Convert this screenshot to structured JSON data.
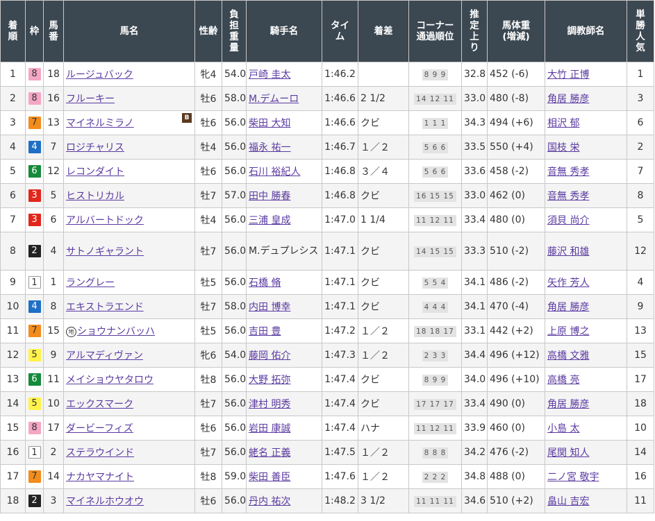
{
  "headers": {
    "rank": "着順",
    "waku": "枠",
    "umaban": "馬番",
    "horse": "馬名",
    "sexage": "性齢",
    "weight": "負担重量",
    "jockey": "騎手名",
    "time": "タイム",
    "margin": "着差",
    "corner": "コーナー通過順位",
    "last3f": "推定上り",
    "bodyweight": "馬体重(増減)",
    "trainer": "調教師名",
    "popularity": "単勝人気"
  },
  "badges": {
    "blinker": "B",
    "chiho": "地"
  },
  "rows": [
    {
      "rank": "1",
      "waku": "8",
      "umaban": "18",
      "horse": "ルージュバック",
      "sexage": "牝4",
      "weight": "54.0",
      "jockey": "戸崎 圭太",
      "time": "1:46.2",
      "margin": "",
      "corner": "8 9 9",
      "last3f": "32.8",
      "bodyweight": "452 (-6)",
      "trainer": "大竹 正博",
      "popularity": "1"
    },
    {
      "rank": "2",
      "waku": "8",
      "umaban": "16",
      "horse": "フルーキー",
      "sexage": "牡6",
      "weight": "58.0",
      "jockey": "M.デムーロ",
      "time": "1:46.6",
      "margin": "2 1/2",
      "corner": "14 12 11",
      "last3f": "33.0",
      "bodyweight": "480 (-8)",
      "trainer": "角居 勝彦",
      "popularity": "3"
    },
    {
      "rank": "3",
      "waku": "7",
      "umaban": "13",
      "horse": "マイネルミラノ",
      "sexage": "牡6",
      "weight": "56.0",
      "jockey": "柴田 大知",
      "time": "1:46.6",
      "margin": "クビ",
      "corner": "1 1 1",
      "last3f": "34.3",
      "bodyweight": "494 (+6)",
      "trainer": "相沢 郁",
      "popularity": "6"
    },
    {
      "rank": "4",
      "waku": "4",
      "umaban": "7",
      "horse": "ロジチャリス",
      "sexage": "牡4",
      "weight": "56.0",
      "jockey": "福永 祐一",
      "time": "1:46.7",
      "margin": "１／２",
      "corner": "5 6 6",
      "last3f": "33.5",
      "bodyweight": "550 (+4)",
      "trainer": "国枝 栄",
      "popularity": "2"
    },
    {
      "rank": "5",
      "waku": "6",
      "umaban": "12",
      "horse": "レコンダイト",
      "sexage": "牡6",
      "weight": "56.0",
      "jockey": "石川 裕紀人",
      "time": "1:46.8",
      "margin": "３／４",
      "corner": "5 6 6",
      "last3f": "33.6",
      "bodyweight": "458 (-2)",
      "trainer": "音無 秀孝",
      "popularity": "7"
    },
    {
      "rank": "6",
      "waku": "3",
      "umaban": "5",
      "horse": "ヒストリカル",
      "sexage": "牡7",
      "weight": "57.0",
      "jockey": "田中 勝春",
      "time": "1:46.8",
      "margin": "クビ",
      "corner": "16 15 15",
      "last3f": "33.0",
      "bodyweight": "462 (0)",
      "trainer": "音無 秀孝",
      "popularity": "8"
    },
    {
      "rank": "7",
      "waku": "3",
      "umaban": "6",
      "horse": "アルバートドック",
      "sexage": "牡4",
      "weight": "56.0",
      "jockey": "三浦 皇成",
      "time": "1:47.0",
      "margin": "1 1/4",
      "corner": "11 12 11",
      "last3f": "33.4",
      "bodyweight": "480 (0)",
      "trainer": "須貝 尚介",
      "popularity": "5"
    },
    {
      "rank": "8",
      "waku": "2",
      "umaban": "4",
      "horse": "サトノギャラント",
      "sexage": "牡7",
      "weight": "56.0",
      "jockey": "M.デュプレシス",
      "time": "1:47.1",
      "margin": "クビ",
      "corner": "14 15 15",
      "last3f": "33.3",
      "bodyweight": "510 (-2)",
      "trainer": "藤沢 和雄",
      "popularity": "12"
    },
    {
      "rank": "9",
      "waku": "1",
      "umaban": "1",
      "horse": "ラングレー",
      "sexage": "牡5",
      "weight": "56.0",
      "jockey": "石橋 脩",
      "time": "1:47.1",
      "margin": "クビ",
      "corner": "5 5 4",
      "last3f": "34.1",
      "bodyweight": "486 (-2)",
      "trainer": "矢作 芳人",
      "popularity": "4"
    },
    {
      "rank": "10",
      "waku": "4",
      "umaban": "8",
      "horse": "エキストラエンド",
      "sexage": "牡7",
      "weight": "58.0",
      "jockey": "内田 博幸",
      "time": "1:47.1",
      "margin": "クビ",
      "corner": "4 4 4",
      "last3f": "34.1",
      "bodyweight": "470 (-4)",
      "trainer": "角居 勝彦",
      "popularity": "9"
    },
    {
      "rank": "11",
      "waku": "7",
      "umaban": "15",
      "horse": "ショウナンバッハ",
      "sexage": "牡5",
      "weight": "56.0",
      "jockey": "吉田 豊",
      "time": "1:47.2",
      "margin": "１／２",
      "corner": "18 18 17",
      "last3f": "33.1",
      "bodyweight": "442 (+2)",
      "trainer": "上原 博之",
      "popularity": "13"
    },
    {
      "rank": "12",
      "waku": "5",
      "umaban": "9",
      "horse": "アルマディヴァン",
      "sexage": "牝6",
      "weight": "54.0",
      "jockey": "藤岡 佑介",
      "time": "1:47.3",
      "margin": "１／２",
      "corner": "2 3 3",
      "last3f": "34.4",
      "bodyweight": "496 (+12)",
      "trainer": "高橋 文雅",
      "popularity": "15"
    },
    {
      "rank": "13",
      "waku": "6",
      "umaban": "11",
      "horse": "メイショウヤタロウ",
      "sexage": "牡8",
      "weight": "56.0",
      "jockey": "大野 拓弥",
      "time": "1:47.4",
      "margin": "クビ",
      "corner": "8 9 9",
      "last3f": "34.0",
      "bodyweight": "496 (+10)",
      "trainer": "高橋 亮",
      "popularity": "17"
    },
    {
      "rank": "14",
      "waku": "5",
      "umaban": "10",
      "horse": "エックスマーク",
      "sexage": "牡7",
      "weight": "56.0",
      "jockey": "津村 明秀",
      "time": "1:47.4",
      "margin": "クビ",
      "corner": "17 17 17",
      "last3f": "33.4",
      "bodyweight": "490 (0)",
      "trainer": "角居 勝彦",
      "popularity": "18"
    },
    {
      "rank": "15",
      "waku": "8",
      "umaban": "17",
      "horse": "ダービーフィズ",
      "sexage": "牡6",
      "weight": "56.0",
      "jockey": "岩田 康誠",
      "time": "1:47.4",
      "margin": "ハナ",
      "corner": "11 12 11",
      "last3f": "33.9",
      "bodyweight": "460 (0)",
      "trainer": "小島 太",
      "popularity": "10"
    },
    {
      "rank": "16",
      "waku": "1",
      "umaban": "2",
      "horse": "ステラウインド",
      "sexage": "牡7",
      "weight": "56.0",
      "jockey": "蛯名 正義",
      "time": "1:47.5",
      "margin": "１／２",
      "corner": "8 8 8",
      "last3f": "34.2",
      "bodyweight": "476 (-2)",
      "trainer": "尾関 知人",
      "popularity": "14"
    },
    {
      "rank": "17",
      "waku": "7",
      "umaban": "14",
      "horse": "ナカヤマナイト",
      "sexage": "牡8",
      "weight": "59.0",
      "jockey": "柴田 善臣",
      "time": "1:47.6",
      "margin": "１／２",
      "corner": "2 2 2",
      "last3f": "34.8",
      "bodyweight": "488 (0)",
      "trainer": "二ノ宮 敬宇",
      "popularity": "16"
    },
    {
      "rank": "18",
      "waku": "2",
      "umaban": "3",
      "horse": "マイネルホウオウ",
      "sexage": "牡6",
      "weight": "56.0",
      "jockey": "丹内 祐次",
      "time": "1:48.2",
      "margin": "3 1/2",
      "corner": "11 11 11",
      "last3f": "34.6",
      "bodyweight": "510 (+2)",
      "trainer": "畠山 吉宏",
      "popularity": "11"
    }
  ]
}
